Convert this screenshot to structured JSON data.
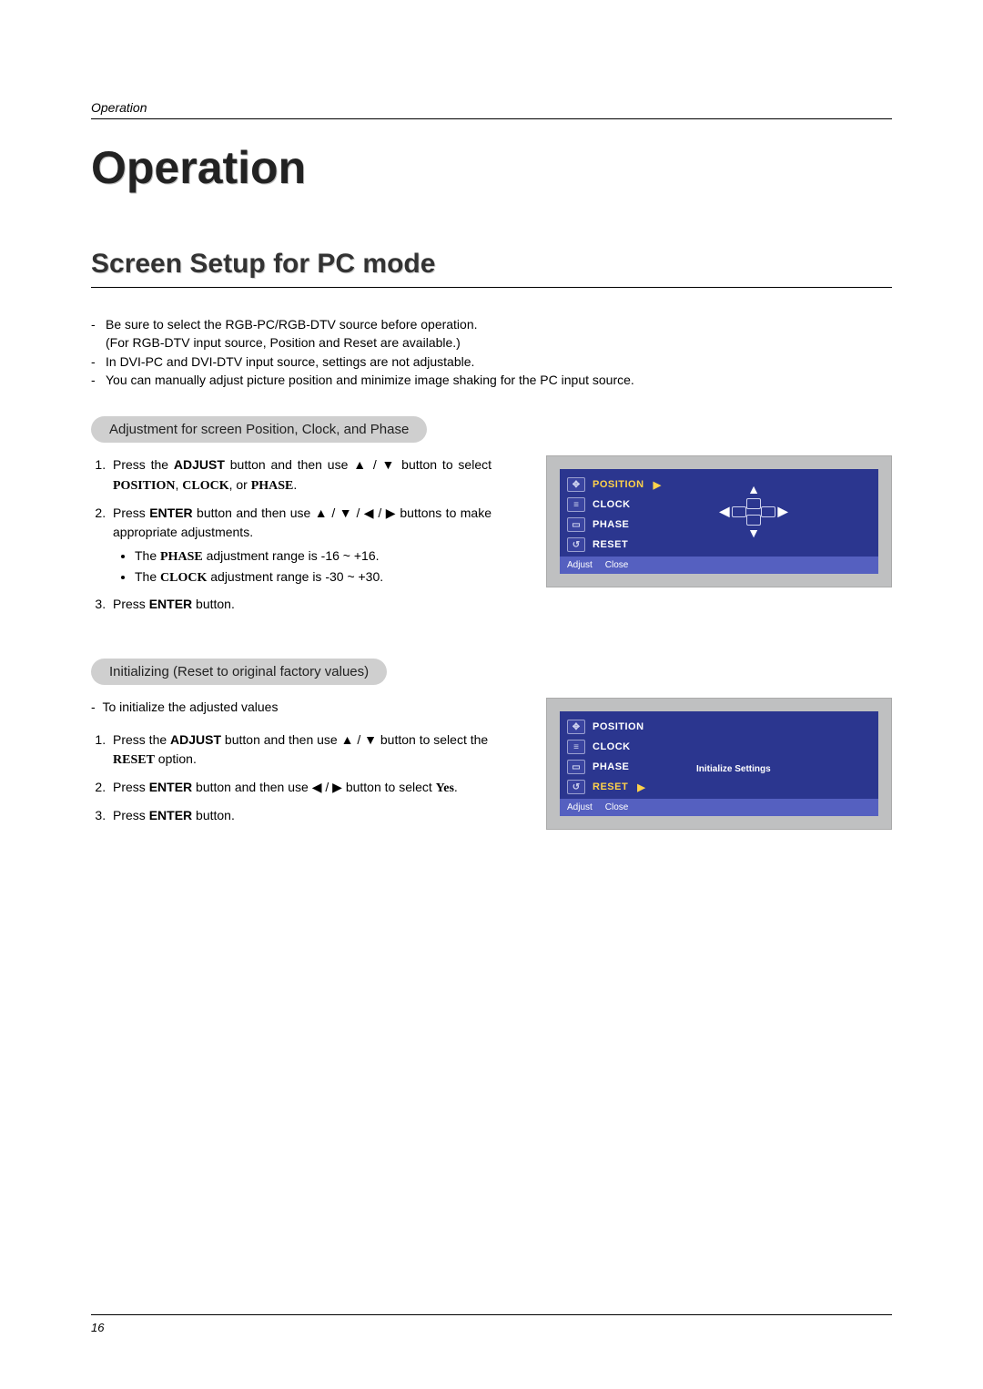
{
  "header": {
    "section_label": "Operation"
  },
  "title": "Operation",
  "subtitle": "Screen Setup for PC mode",
  "intro": {
    "l1": "Be sure to select the RGB-PC/RGB-DTV source before operation.",
    "l1b": "(For RGB-DTV input source, Position and Reset are available.)",
    "l2": "In DVI-PC and DVI-DTV input source, settings are not adjustable.",
    "l3": "You can manually adjust picture position and minimize image shaking for the PC input source."
  },
  "section1": {
    "pill": "Adjustment for screen Position, Clock, and Phase",
    "step1a": "Press the ",
    "step1_adjust": "ADJUST",
    "step1b": " button and then use ",
    "step1c": " button to select ",
    "step1_position": "POSITION",
    "step1_sep": ", ",
    "step1_clock": "CLOCK",
    "step1_or": ", or ",
    "step1_phase": "PHASE",
    "step1_end": ".",
    "step2a": "Press ",
    "step2_enter": "ENTER",
    "step2b": " button and then use ",
    "step2c": " buttons to make appropriate adjustments.",
    "sub1a": "The ",
    "sub1_phase": "PHASE",
    "sub1b": " adjustment range is -16 ~ +16.",
    "sub2a": "The ",
    "sub2_clock": "CLOCK",
    "sub2b": " adjustment range is -30 ~ +30.",
    "step3a": "Press ",
    "step3_enter": "ENTER",
    "step3b": " button."
  },
  "section2": {
    "pill": "Initializing (Reset to original factory values)",
    "intro_dash": "-",
    "intro": "To initialize the adjusted values",
    "step1a": "Press the ",
    "step1_adjust": "ADJUST",
    "step1b": " button and then use ",
    "step1c": " button to select the ",
    "step1_reset": "RESET",
    "step1d": " option.",
    "step2a": "Press ",
    "step2_enter": "ENTER",
    "step2b": " button and then use ",
    "step2c": " button to select ",
    "step2_yes": "Yes",
    "step2d": ".",
    "step3a": "Press ",
    "step3_enter": "ENTER",
    "step3b": " button."
  },
  "osd": {
    "items": {
      "position": "POSITION",
      "clock": "CLOCK",
      "phase": "PHASE",
      "reset": "RESET"
    },
    "foot_adjust": "Adjust",
    "foot_close": "Close",
    "init_settings": "Initialize Settings"
  },
  "sym": {
    "up": "▲",
    "down": "▼",
    "left": "◀",
    "right": "▶",
    "sep": " / "
  },
  "footer": {
    "page": "16"
  }
}
